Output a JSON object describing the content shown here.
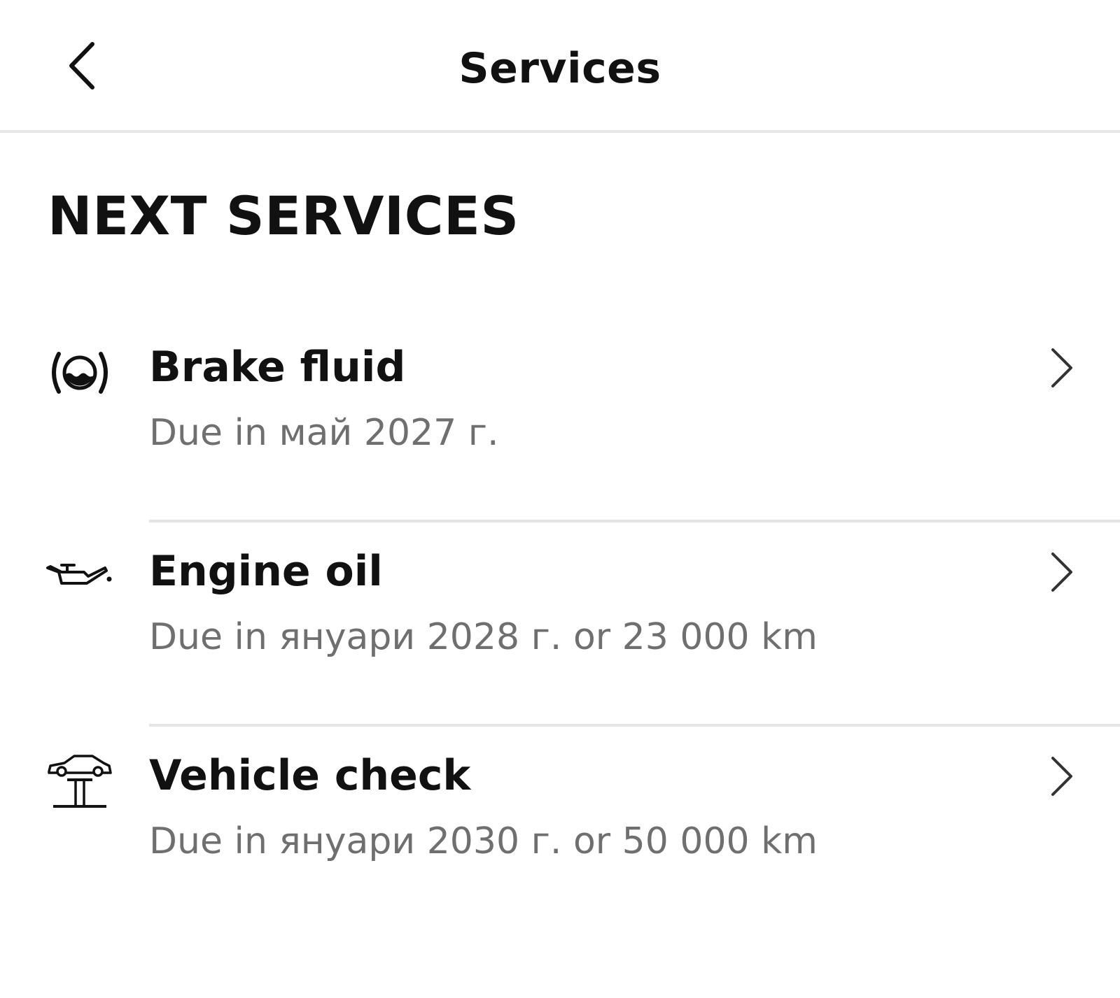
{
  "header": {
    "title": "Services",
    "back_icon": "chevron-left-icon"
  },
  "section": {
    "title": "NEXT SERVICES"
  },
  "services": [
    {
      "name": "Brake fluid",
      "due": "Due in май 2027 г.",
      "icon": "brake-fluid-icon"
    },
    {
      "name": "Engine oil",
      "due": "Due in януари 2028 г. or 23 000 km",
      "icon": "oil-can-icon"
    },
    {
      "name": "Vehicle check",
      "due": "Due in януари 2030 г. or 50 000 km",
      "icon": "car-lift-icon"
    }
  ],
  "colors": {
    "text_primary": "#111111",
    "text_secondary": "#6f6f6f",
    "divider": "#e4e4e4",
    "background": "#ffffff"
  }
}
